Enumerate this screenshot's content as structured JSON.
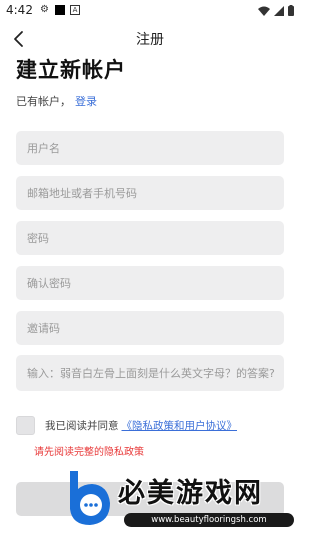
{
  "status": {
    "time": "4:42"
  },
  "header": {
    "title": "注册"
  },
  "page": {
    "heading": "建立新帐户"
  },
  "login": {
    "prompt": "已有帐户，",
    "link": "登录"
  },
  "form": {
    "username_placeholder": "用户名",
    "contact_placeholder": "邮箱地址或者手机号码",
    "password_placeholder": "密码",
    "confirm_password_placeholder": "确认密码",
    "invite_code_placeholder": "邀请码",
    "captcha_placeholder": "输入：弱音白左骨上面刻是什么英文字母？的答案?"
  },
  "agreement": {
    "text": "我已阅读并同意",
    "link": "《隐私政策和用户协议》",
    "error": "请先阅读完整的隐私政策"
  },
  "watermark": {
    "title": "必美游戏网",
    "url": "www.beautyflooringsh.com"
  }
}
